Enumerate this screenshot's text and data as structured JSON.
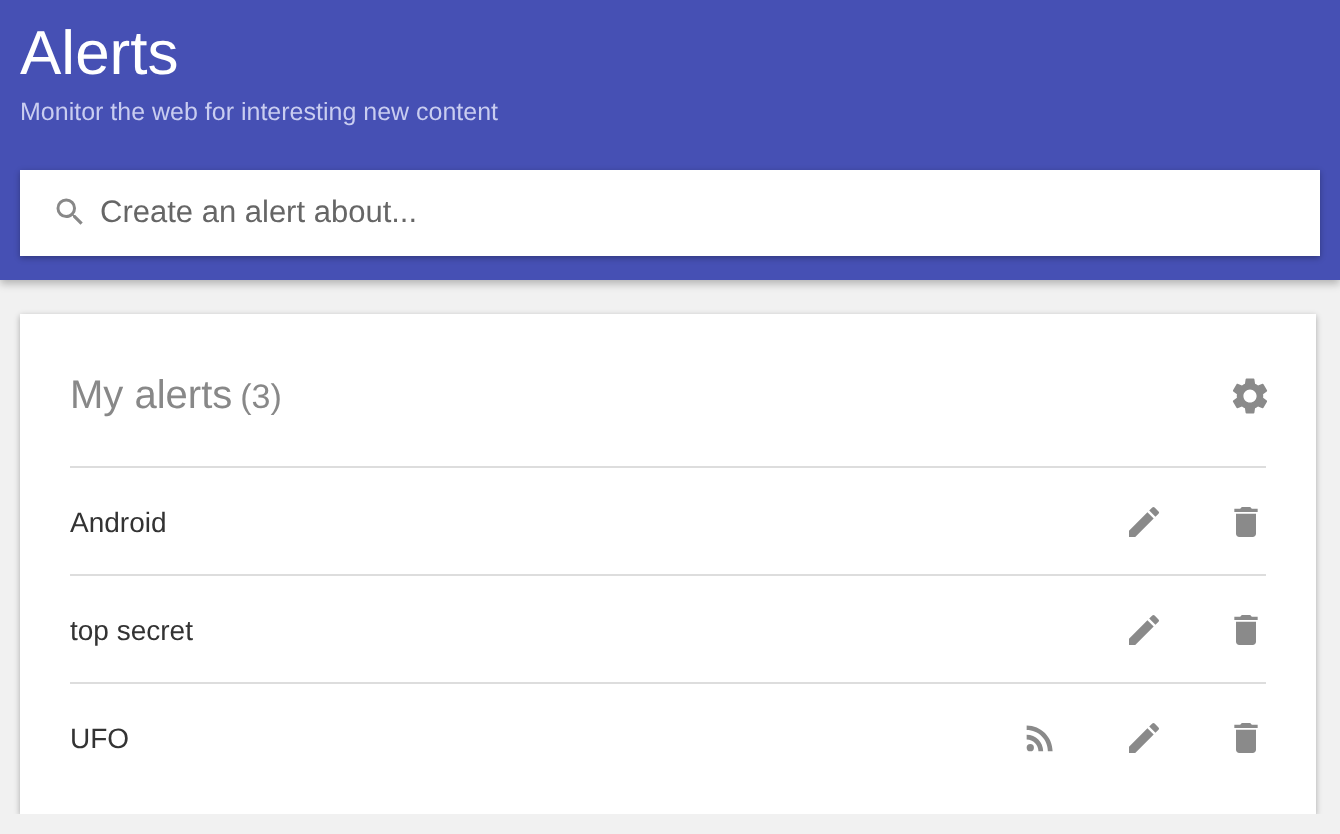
{
  "header": {
    "title": "Alerts",
    "subtitle": "Monitor the web for interesting new content"
  },
  "search": {
    "placeholder": "Create an alert about..."
  },
  "alerts_card": {
    "title": "My alerts",
    "count": "(3)",
    "items": [
      {
        "name": "Android",
        "feed": false
      },
      {
        "name": "top secret",
        "feed": false
      },
      {
        "name": "UFO",
        "feed": true
      }
    ]
  }
}
